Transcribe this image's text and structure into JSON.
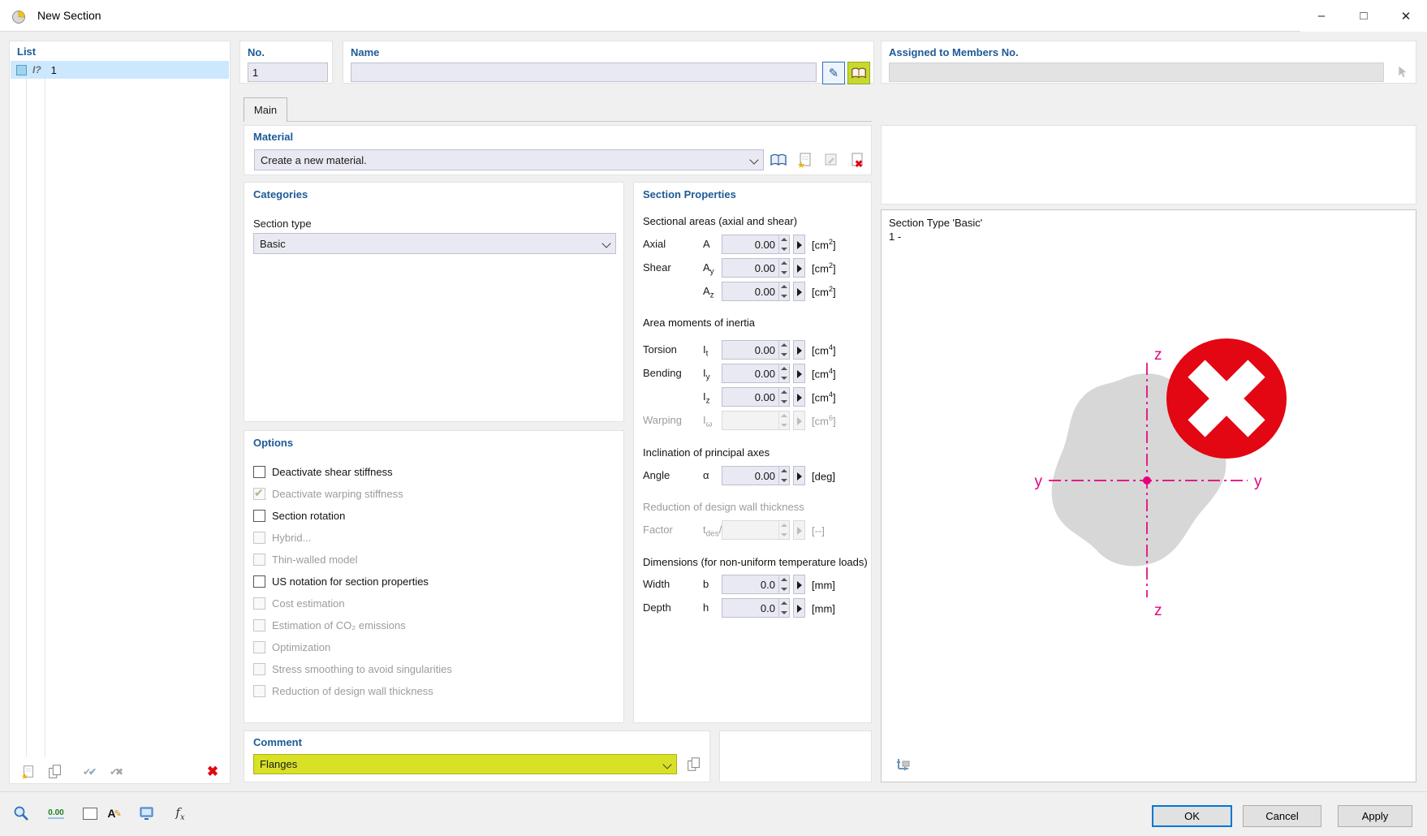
{
  "window": {
    "title": "New Section"
  },
  "icons": {
    "minimize": "–",
    "maximize": "□",
    "close": "✕",
    "pencil": "✎",
    "red_x": "✖",
    "check": "✔"
  },
  "toolbar": {
    "decimal_text": "0.00",
    "fx_f": "f",
    "fx_x": "x",
    "font_a": "A"
  },
  "list_panel": {
    "header": "List",
    "rows": [
      {
        "icon": "I?",
        "label": "1",
        "selected": true
      }
    ]
  },
  "header_fields": {
    "no": {
      "label": "No.",
      "value": "1"
    },
    "name": {
      "label": "Name",
      "value": ""
    },
    "assigned": {
      "label": "Assigned to Members No.",
      "value": ""
    }
  },
  "tabs": {
    "main_label": "Main"
  },
  "material": {
    "header": "Material",
    "selected_option": "Create a new material."
  },
  "categories": {
    "header": "Categories",
    "section_type_label": "Section type",
    "section_type_value": "Basic"
  },
  "options": {
    "header": "Options",
    "items": [
      {
        "label": "Deactivate shear stiffness",
        "checked": false,
        "enabled": true
      },
      {
        "label": "Deactivate warping stiffness",
        "checked": true,
        "enabled": false
      },
      {
        "label": "Section rotation",
        "checked": false,
        "enabled": true
      },
      {
        "label": "Hybrid...",
        "checked": false,
        "enabled": false
      },
      {
        "label": "Thin-walled model",
        "checked": false,
        "enabled": false
      },
      {
        "label": "US notation for section properties",
        "checked": false,
        "enabled": true
      },
      {
        "label": "Cost estimation",
        "checked": false,
        "enabled": false
      },
      {
        "label": "Estimation of CO₂ emissions",
        "checked": false,
        "enabled": false
      },
      {
        "label": "Optimization",
        "checked": false,
        "enabled": false
      },
      {
        "label": "Stress smoothing to avoid singularities",
        "checked": false,
        "enabled": false
      },
      {
        "label": "Reduction of design wall thickness",
        "checked": false,
        "enabled": false
      }
    ]
  },
  "section_properties": {
    "header": "Section Properties",
    "group_titles": {
      "areas": "Sectional areas (axial and shear)",
      "inertia": "Area moments of inertia",
      "inclination": "Inclination of principal axes",
      "reduction": "Reduction of design wall thickness",
      "dimensions": "Dimensions (for non-uniform temperature loads)"
    },
    "rows": [
      {
        "label": "Axial",
        "sym": "A",
        "sym_sub": "",
        "sym_post": "",
        "value": "0.00",
        "unit": "[cm",
        "unit_sup": "2",
        "unit_close": "]",
        "enabled": true
      },
      {
        "label": "Shear",
        "sym": "A",
        "sym_sub": "y",
        "sym_post": "",
        "value": "0.00",
        "unit": "[cm",
        "unit_sup": "2",
        "unit_close": "]",
        "enabled": true
      },
      {
        "label": "",
        "sym": "A",
        "sym_sub": "z",
        "sym_post": "",
        "value": "0.00",
        "unit": "[cm",
        "unit_sup": "2",
        "unit_close": "]",
        "enabled": true
      },
      {
        "label": "Torsion",
        "sym": "I",
        "sym_sub": "t",
        "sym_post": "",
        "value": "0.00",
        "unit": "[cm",
        "unit_sup": "4",
        "unit_close": "]",
        "enabled": true
      },
      {
        "label": "Bending",
        "sym": "I",
        "sym_sub": "y",
        "sym_post": "",
        "value": "0.00",
        "unit": "[cm",
        "unit_sup": "4",
        "unit_close": "]",
        "enabled": true
      },
      {
        "label": "",
        "sym": "I",
        "sym_sub": "z",
        "sym_post": "",
        "value": "0.00",
        "unit": "[cm",
        "unit_sup": "4",
        "unit_close": "]",
        "enabled": true
      },
      {
        "label": "Warping",
        "sym": "I",
        "sym_sub": "ω",
        "sym_post": "",
        "value": "",
        "unit": "[cm",
        "unit_sup": "6",
        "unit_close": "]",
        "enabled": false
      },
      {
        "label": "Angle",
        "sym": "α",
        "sym_sub": "",
        "sym_post": "",
        "value": "0.00",
        "unit": "[deg",
        "unit_sup": "",
        "unit_close": "]",
        "enabled": true
      },
      {
        "label": "Factor",
        "sym": "t",
        "sym_sub": "des",
        "sym_post": "/t",
        "value": "",
        "unit": "[--",
        "unit_sup": "",
        "unit_close": "]",
        "enabled": false
      },
      {
        "label": "Width",
        "sym": "b",
        "sym_sub": "",
        "sym_post": "",
        "value": "0.0",
        "unit": "[mm",
        "unit_sup": "",
        "unit_close": "]",
        "enabled": true
      },
      {
        "label": "Depth",
        "sym": "h",
        "sym_sub": "",
        "sym_post": "",
        "value": "0.0",
        "unit": "[mm",
        "unit_sup": "",
        "unit_close": "]",
        "enabled": true
      }
    ]
  },
  "comment": {
    "header": "Comment",
    "value": "Flanges"
  },
  "preview": {
    "type_line": "Section Type 'Basic'",
    "id_line": "1 -",
    "axis_y_label": "y",
    "axis_z_label": "z"
  },
  "footer": {
    "ok_label": "OK",
    "cancel_label": "Cancel",
    "apply_label": "Apply"
  },
  "colors": {
    "accent_blue": "#1d5a96",
    "selection": "#cce8ff",
    "magenta": "#e6007e",
    "error_red": "#e30613",
    "comment_yellow": "#d9e126"
  }
}
